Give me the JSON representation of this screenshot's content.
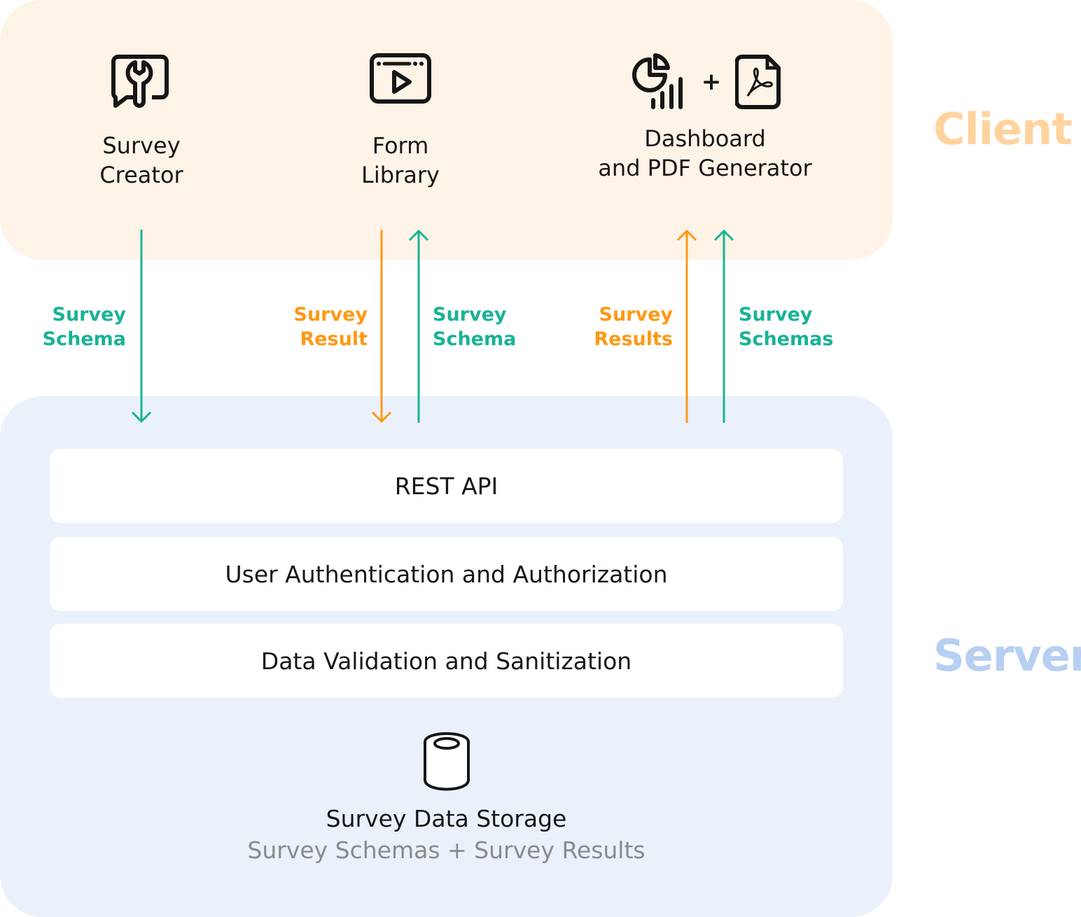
{
  "zones": {
    "client": {
      "label": "Client",
      "color": "#ffd39e",
      "background": "#fdf3e7"
    },
    "server": {
      "label": "Server",
      "color": "#b6cff2",
      "background": "#eaf1fb"
    }
  },
  "client_components": [
    {
      "id": "survey-creator",
      "icon": "chat-wrench-icon",
      "line1": "Survey",
      "line2": "Creator"
    },
    {
      "id": "form-library",
      "icon": "browser-play-icon",
      "line1": "Form",
      "line2": "Library"
    },
    {
      "id": "dashboard-pdf",
      "icons": [
        "pie-chart-bars-icon",
        "pdf-file-icon"
      ],
      "plus": "+",
      "line1": "Dashboard",
      "line2": "and PDF Generator"
    }
  ],
  "flows": [
    {
      "direction": "down",
      "color": "#19b394",
      "line1": "Survey",
      "line2": "Schema",
      "from": "Survey Creator",
      "to": "Server"
    },
    {
      "direction": "down",
      "color": "#ff9814",
      "line1": "Survey",
      "line2": "Result",
      "from": "Form Library",
      "to": "Server"
    },
    {
      "direction": "up",
      "color": "#19b394",
      "line1": "Survey",
      "line2": "Schema",
      "from": "Server",
      "to": "Form Library"
    },
    {
      "direction": "up",
      "color": "#ff9814",
      "line1": "Survey",
      "line2": "Results",
      "from": "Server",
      "to": "Dashboard and PDF Generator"
    },
    {
      "direction": "up",
      "color": "#19b394",
      "line1": "Survey",
      "line2": "Schemas",
      "from": "Server",
      "to": "Dashboard and PDF Generator"
    }
  ],
  "server_layers": [
    {
      "label": "REST API"
    },
    {
      "label": "User Authentication and Authorization"
    },
    {
      "label": "Data Validation and Sanitization"
    }
  ],
  "storage": {
    "icon": "database-icon",
    "title": "Survey Data Storage",
    "subtitle": "Survey Schemas + Survey Results"
  },
  "colors": {
    "schema": "#19b394",
    "result": "#ff9814",
    "text": "#161616",
    "muted": "#8a8a8a"
  }
}
